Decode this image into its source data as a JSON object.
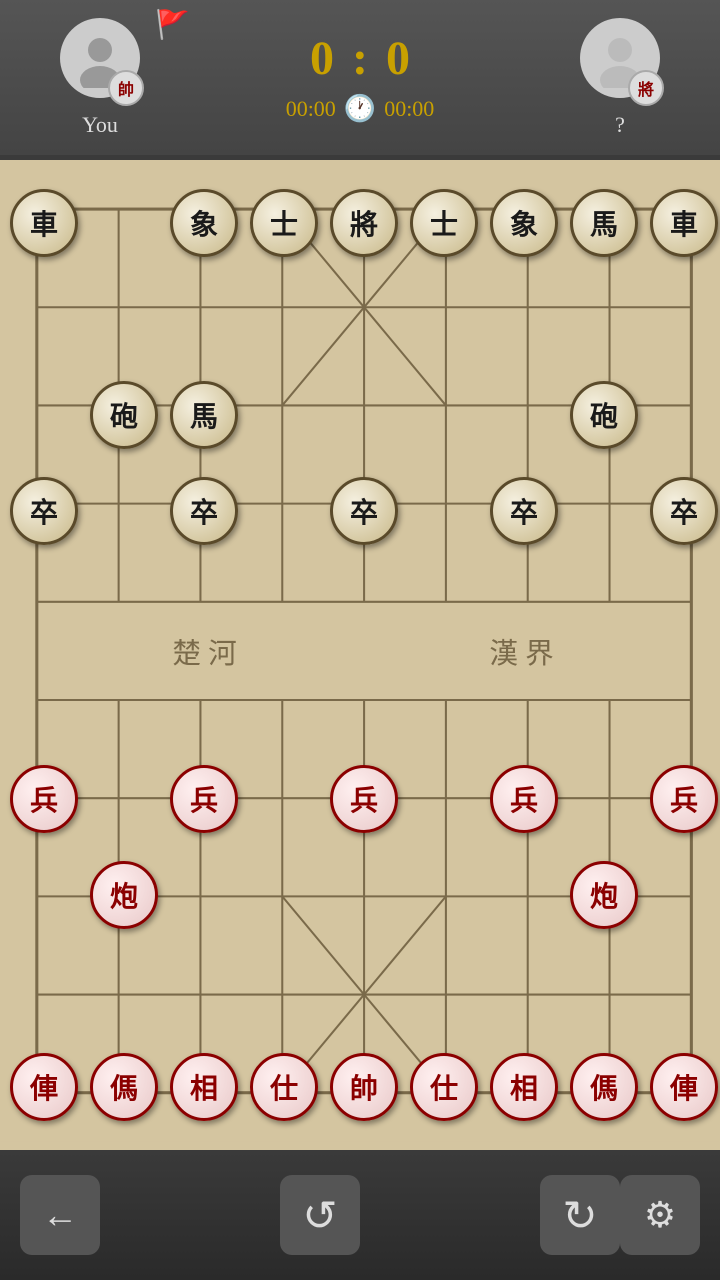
{
  "header": {
    "player1": {
      "name": "You",
      "badge": "帥",
      "avatar_alt": "player1-avatar"
    },
    "player2": {
      "name": "?",
      "badge": "將",
      "avatar_alt": "player2-avatar"
    },
    "score1": "0",
    "score2": "0",
    "separator": ":",
    "timer1": "00:00",
    "timer2": "00:00"
  },
  "toolbar": {
    "back_label": "←",
    "undo_label": "↺",
    "refresh_label": "↻",
    "settings_label": "⚙"
  },
  "board": {
    "black_pieces": [
      {
        "char": "車",
        "col": 0,
        "row": 0
      },
      {
        "char": "象",
        "col": 2,
        "row": 0
      },
      {
        "char": "士",
        "col": 3,
        "row": 0
      },
      {
        "char": "將",
        "col": 4,
        "row": 0
      },
      {
        "char": "士",
        "col": 5,
        "row": 0
      },
      {
        "char": "象",
        "col": 6,
        "row": 0
      },
      {
        "char": "馬",
        "col": 7,
        "row": 0
      },
      {
        "char": "車",
        "col": 8,
        "row": 0
      },
      {
        "char": "砲",
        "col": 1,
        "row": 2
      },
      {
        "char": "馬",
        "col": 2,
        "row": 2
      },
      {
        "char": "砲",
        "col": 7,
        "row": 2
      },
      {
        "char": "卒",
        "col": 0,
        "row": 3
      },
      {
        "char": "卒",
        "col": 2,
        "row": 3
      },
      {
        "char": "卒",
        "col": 4,
        "row": 3
      },
      {
        "char": "卒",
        "col": 6,
        "row": 3
      },
      {
        "char": "卒",
        "col": 8,
        "row": 3
      }
    ],
    "red_pieces": [
      {
        "char": "兵",
        "col": 0,
        "row": 6
      },
      {
        "char": "兵",
        "col": 2,
        "row": 6
      },
      {
        "char": "兵",
        "col": 4,
        "row": 6
      },
      {
        "char": "兵",
        "col": 6,
        "row": 6
      },
      {
        "char": "兵",
        "col": 8,
        "row": 6
      },
      {
        "char": "炮",
        "col": 1,
        "row": 7
      },
      {
        "char": "炮",
        "col": 7,
        "row": 7
      },
      {
        "char": "俥",
        "col": 0,
        "row": 9
      },
      {
        "char": "傌",
        "col": 1,
        "row": 9
      },
      {
        "char": "相",
        "col": 2,
        "row": 9
      },
      {
        "char": "仕",
        "col": 3,
        "row": 9
      },
      {
        "char": "帥",
        "col": 4,
        "row": 9
      },
      {
        "char": "仕",
        "col": 5,
        "row": 9
      },
      {
        "char": "相",
        "col": 6,
        "row": 9
      },
      {
        "char": "傌",
        "col": 7,
        "row": 9
      },
      {
        "char": "俥",
        "col": 8,
        "row": 9
      }
    ]
  }
}
